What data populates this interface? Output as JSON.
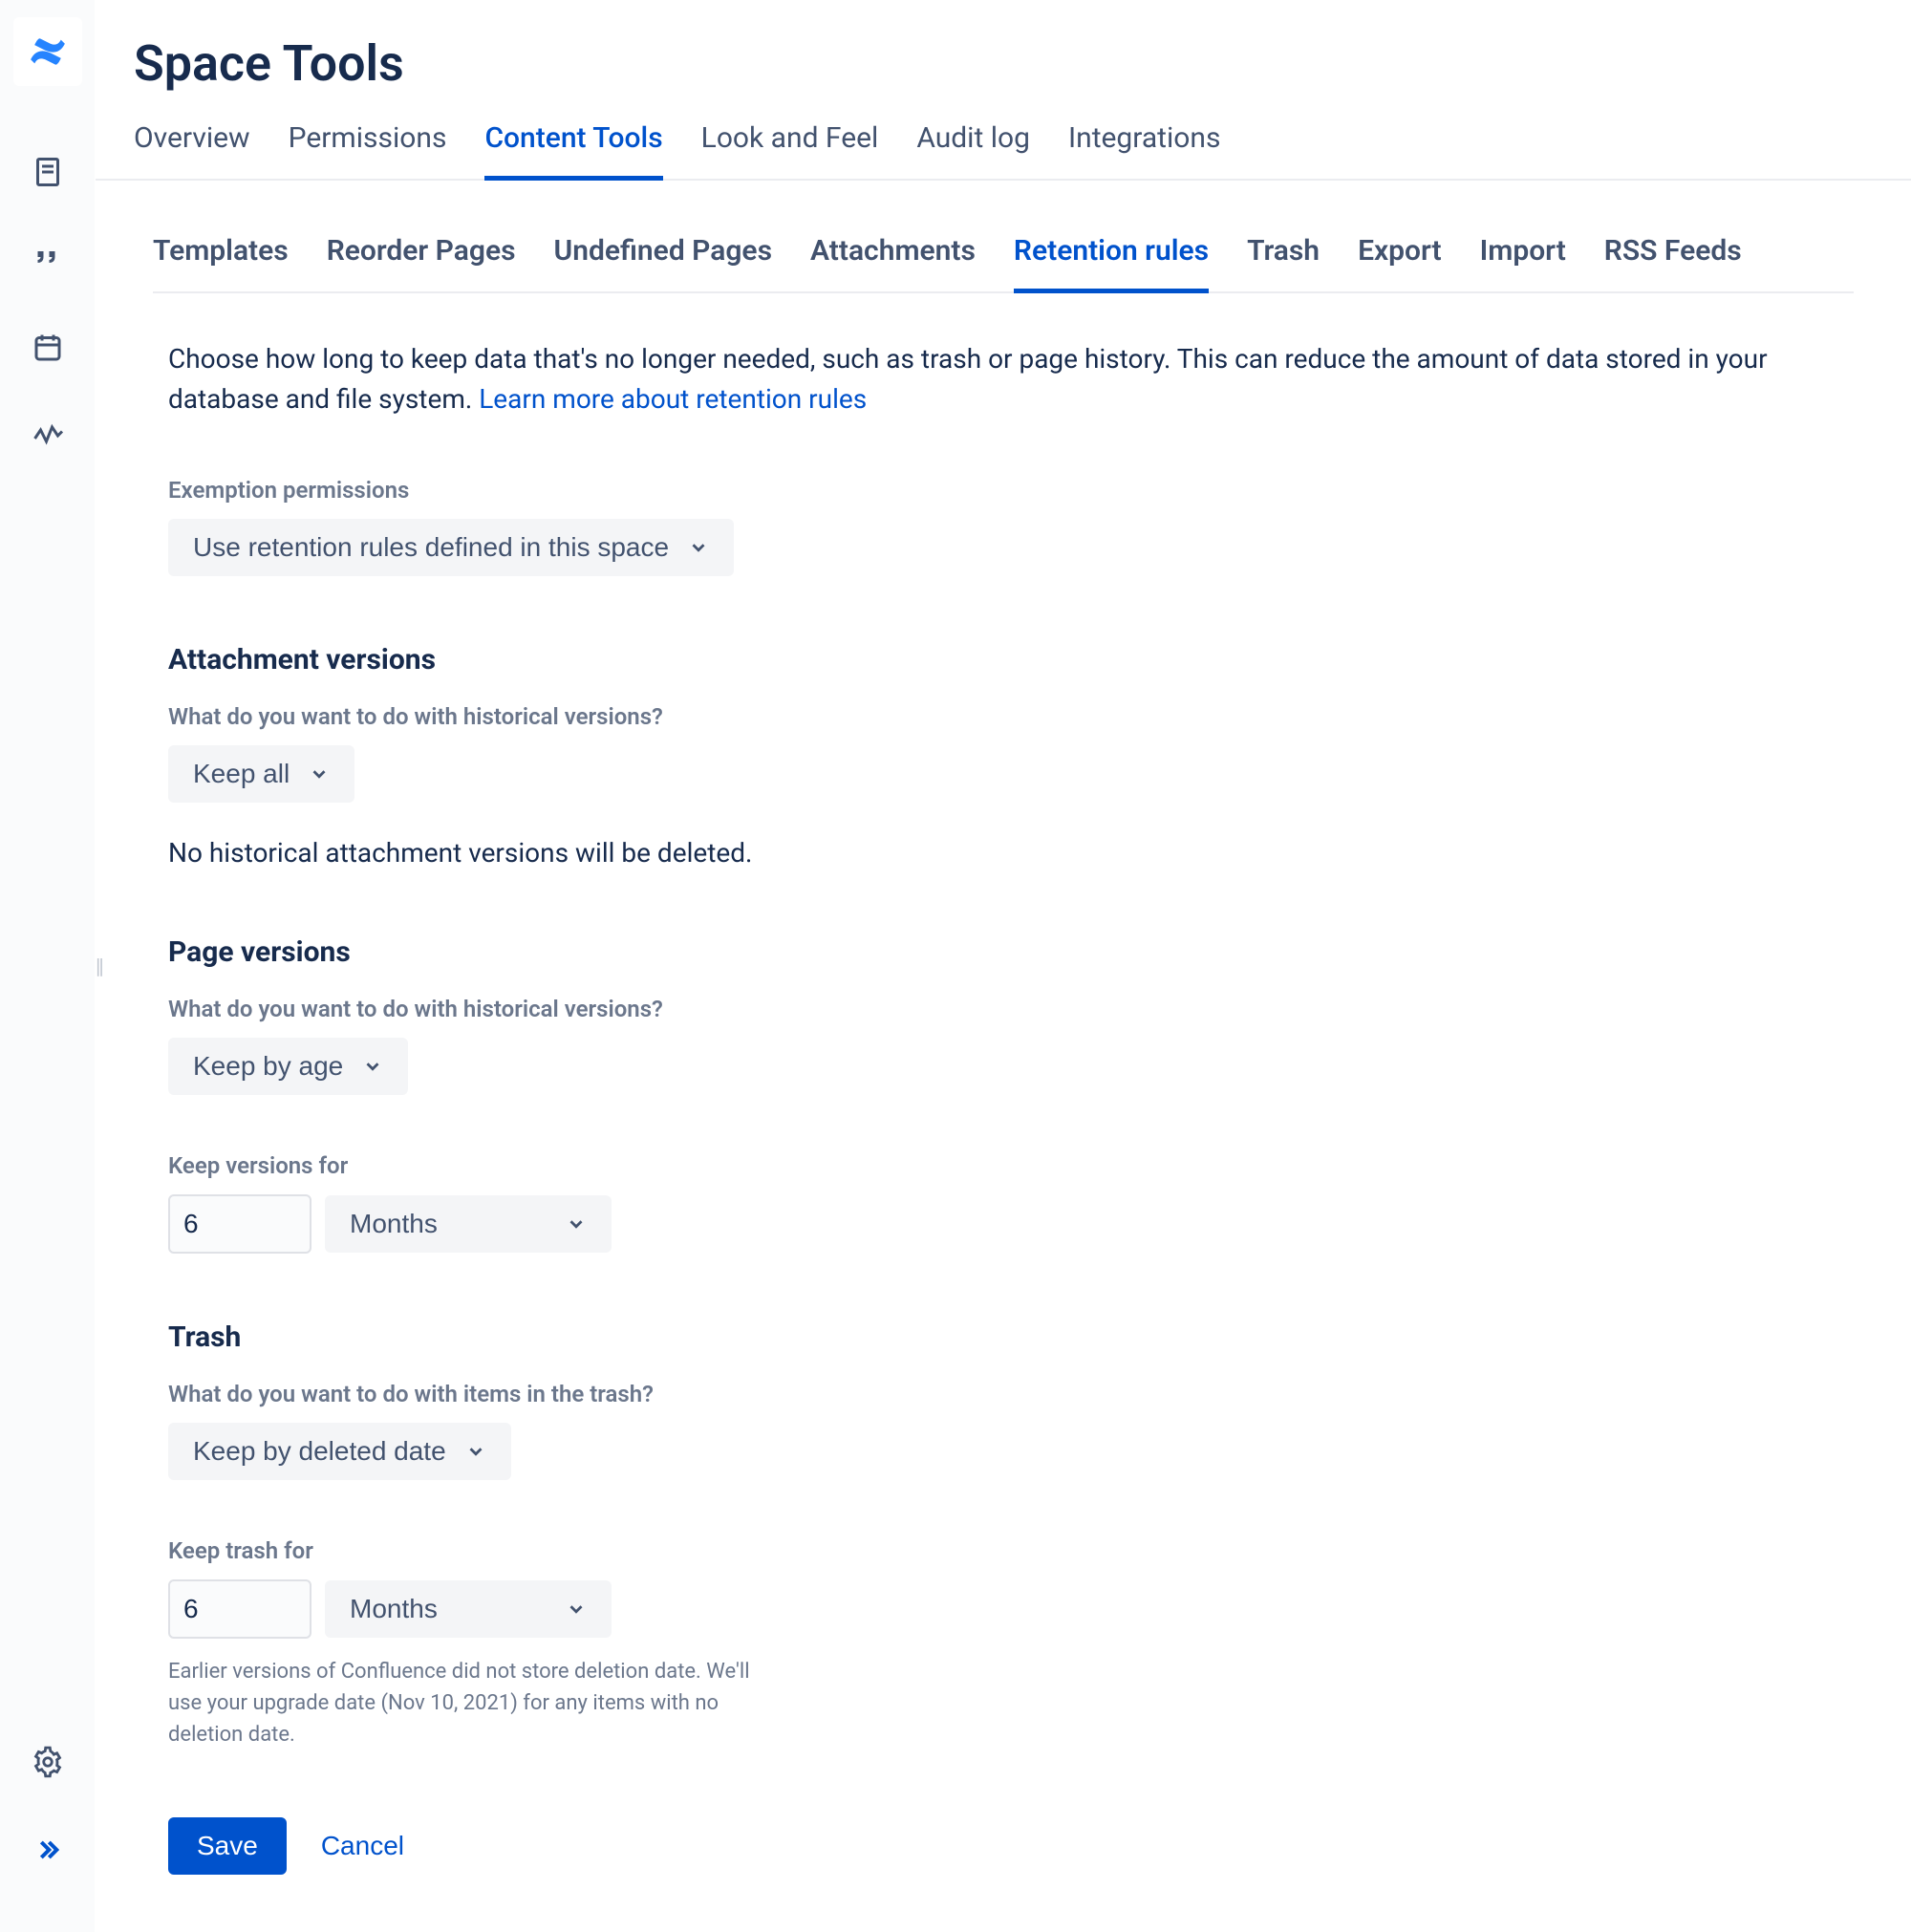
{
  "header": {
    "title": "Space Tools"
  },
  "tabs_primary": [
    "Overview",
    "Permissions",
    "Content Tools",
    "Look and Feel",
    "Audit log",
    "Integrations"
  ],
  "tabs_primary_active": 2,
  "tabs_secondary": [
    "Templates",
    "Reorder Pages",
    "Undefined Pages",
    "Attachments",
    "Retention rules",
    "Trash",
    "Export",
    "Import",
    "RSS Feeds"
  ],
  "tabs_secondary_active": 4,
  "intro": {
    "text": "Choose how long to keep data that's no longer needed, such as trash or page history. This can reduce the amount of data stored in your database and file system. ",
    "link_text": "Learn more about retention rules"
  },
  "exemption": {
    "label": "Exemption permissions",
    "value": "Use retention rules defined in this space"
  },
  "attachment": {
    "title": "Attachment versions",
    "question": "What do you want to do with historical versions?",
    "value": "Keep all",
    "helper": "No historical attachment versions will be deleted."
  },
  "page": {
    "title": "Page versions",
    "question": "What do you want to do with historical versions?",
    "value": "Keep by age",
    "keep_label": "Keep versions for",
    "keep_number": "6",
    "keep_unit": "Months"
  },
  "trash": {
    "title": "Trash",
    "question": "What do you want to do with items in the trash?",
    "value": "Keep by deleted date",
    "keep_label": "Keep trash for",
    "keep_number": "6",
    "keep_unit": "Months",
    "note": "Earlier versions of Confluence did not store deletion date. We'll use your upgrade date (Nov 10, 2021) for any items with no deletion date."
  },
  "actions": {
    "save": "Save",
    "cancel": "Cancel"
  },
  "icons": {
    "logo": "confluence-logo",
    "side": [
      "page-icon",
      "quote-icon",
      "calendar-icon",
      "analytics-icon"
    ],
    "bottom": [
      "gear-icon",
      "expand-icon"
    ]
  }
}
